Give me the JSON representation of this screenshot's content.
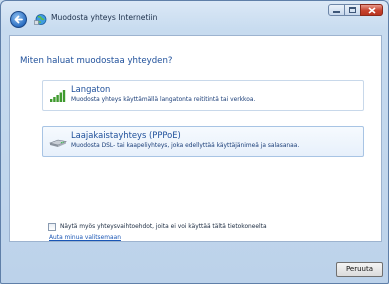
{
  "window": {
    "title": "Muodosta yhteys Internetiin",
    "caption_buttons": [
      "minimize",
      "maximize",
      "close"
    ]
  },
  "heading": "Miten haluat muodostaa yhteyden?",
  "options": [
    {
      "title": "Langaton",
      "description": "Muodosta yhteys käyttämällä langatonta reititintä tai verkkoa.",
      "icon": "wireless-signal-icon",
      "selected": false
    },
    {
      "title": "Laajakaistayhteys (PPPoE)",
      "description": "Muodosta DSL- tai kaapeliyhteys, joka edellyttää käyttäjänimeä ja salasanaa.",
      "icon": "broadband-modem-icon",
      "selected": true
    }
  ],
  "show_other_options": {
    "label": "Näytä myös yhteysvaihtoehdot, joita ei voi käyttää tältä tietokoneelta",
    "checked": false
  },
  "help_link": "Auta minua valitsemaan",
  "cancel_button": "Peruuta",
  "colors": {
    "heading": "#1e4f9a",
    "link": "#1a56b5",
    "close_button": "#c7422e"
  }
}
